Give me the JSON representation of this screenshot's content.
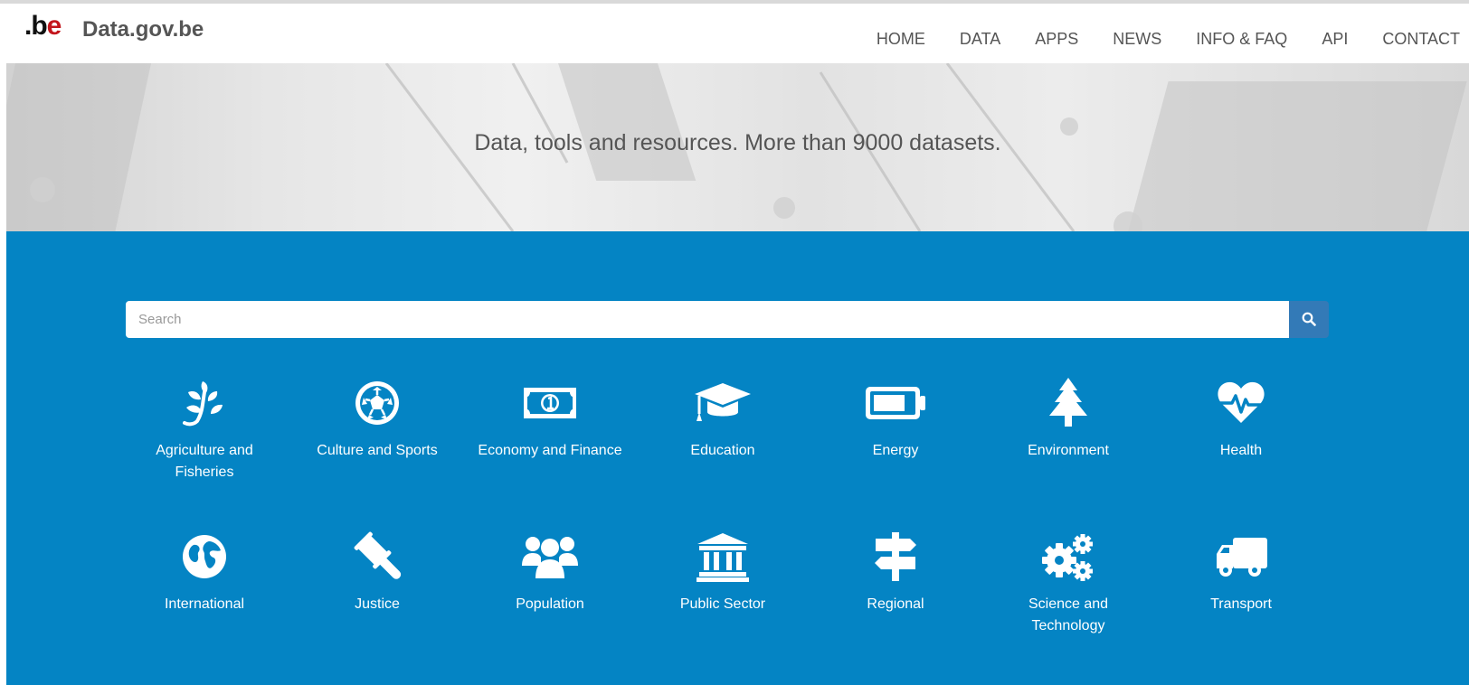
{
  "header": {
    "logo_text": ".be",
    "site_name": "Data.gov.be",
    "nav": [
      "HOME",
      "DATA",
      "APPS",
      "NEWS",
      "INFO & FAQ",
      "API",
      "CONTACT"
    ]
  },
  "hero": {
    "tagline": "Data, tools and resources. More than 9000 datasets."
  },
  "search": {
    "placeholder": "Search",
    "button_icon": "search-icon"
  },
  "categories": [
    {
      "label": "Agriculture and Fisheries",
      "icon": "leaf-icon"
    },
    {
      "label": "Culture and Sports",
      "icon": "soccer-ball-icon"
    },
    {
      "label": "Economy and Finance",
      "icon": "banknote-icon"
    },
    {
      "label": "Education",
      "icon": "graduation-cap-icon"
    },
    {
      "label": "Energy",
      "icon": "battery-icon"
    },
    {
      "label": "Environment",
      "icon": "tree-icon"
    },
    {
      "label": "Health",
      "icon": "heartbeat-icon"
    },
    {
      "label": "International",
      "icon": "globe-icon"
    },
    {
      "label": "Justice",
      "icon": "gavel-icon"
    },
    {
      "label": "Population",
      "icon": "users-icon"
    },
    {
      "label": "Public Sector",
      "icon": "institution-icon"
    },
    {
      "label": "Regional",
      "icon": "signpost-icon"
    },
    {
      "label": "Science and Technology",
      "icon": "cogs-icon"
    },
    {
      "label": "Transport",
      "icon": "truck-icon"
    }
  ],
  "colors": {
    "main_blue": "#0484c4",
    "search_button": "#337ab7",
    "logo_red": "#c3161c"
  }
}
